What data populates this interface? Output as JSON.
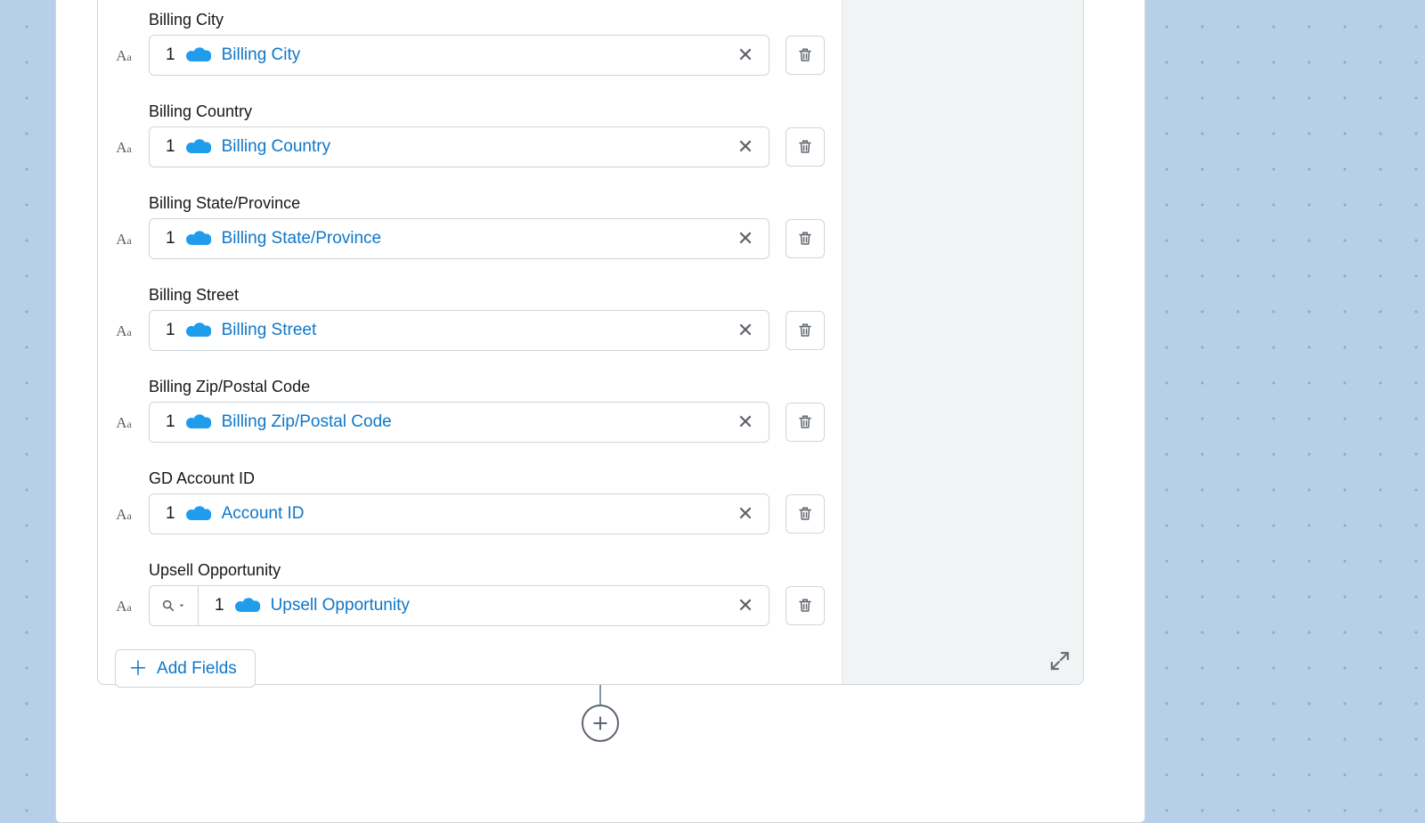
{
  "rows": [
    {
      "label": "Billing City",
      "index": "1",
      "value": "Billing City",
      "hasSearch": false
    },
    {
      "label": "Billing Country",
      "index": "1",
      "value": "Billing Country",
      "hasSearch": false
    },
    {
      "label": "Billing State/Province",
      "index": "1",
      "value": "Billing State/Province",
      "hasSearch": false
    },
    {
      "label": "Billing Street",
      "index": "1",
      "value": "Billing Street",
      "hasSearch": false
    },
    {
      "label": "Billing Zip/Postal Code",
      "index": "1",
      "value": "Billing Zip/Postal Code",
      "hasSearch": false
    },
    {
      "label": "GD Account ID",
      "index": "1",
      "value": "Account ID",
      "hasSearch": false
    },
    {
      "label": "Upsell Opportunity",
      "index": "1",
      "value": "Upsell Opportunity",
      "hasSearch": true
    }
  ],
  "buttons": {
    "addFields": "Add Fields"
  },
  "glyphs": {
    "clear": "✕",
    "plus": "＋"
  },
  "icons": {
    "type": "Aa",
    "cloud": "salesforce-cloud-icon",
    "trash": "trash-icon",
    "search": "search-icon",
    "caret": "caret-down-icon",
    "expand": "expand-icon",
    "addNode": "add-node-icon"
  },
  "colors": {
    "link": "#0f77c9",
    "border": "#cfd6dc",
    "bg": "#b8cfea",
    "iconGray": "#626970"
  }
}
